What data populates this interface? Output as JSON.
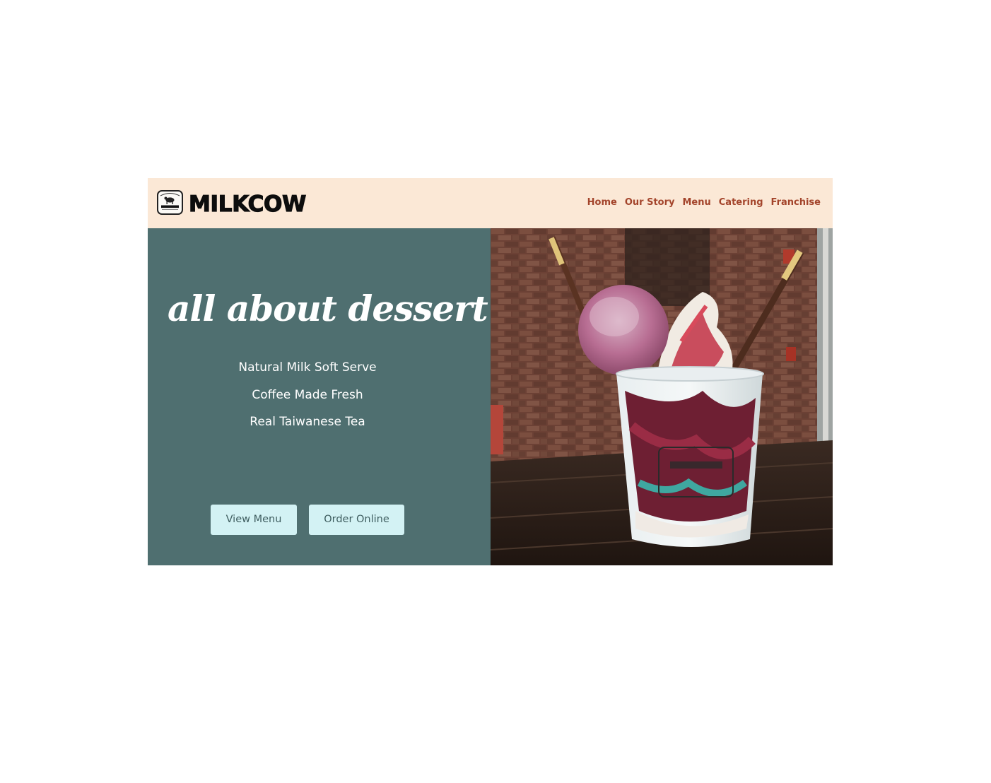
{
  "header": {
    "brand_name": "MILKCOW",
    "logo_icon": "cow-logo-icon",
    "background_color": "#fbe8d6",
    "nav_color": "#a3442b",
    "nav": [
      {
        "label": "Home"
      },
      {
        "label": "Our Story"
      },
      {
        "label": "Menu"
      },
      {
        "label": "Catering"
      },
      {
        "label": "Franchise"
      }
    ]
  },
  "hero": {
    "background_color": "#4f6f70",
    "tagline": "all about dessert",
    "features": [
      "Natural Milk Soft Serve",
      "Coffee Made Fresh",
      "Real Taiwanese Tea"
    ],
    "buttons": {
      "view_menu": "View Menu",
      "order_online": "Order Online",
      "button_color": "#d3f2f4"
    },
    "image": {
      "subject": "soft-serve-sundae-photo"
    }
  }
}
